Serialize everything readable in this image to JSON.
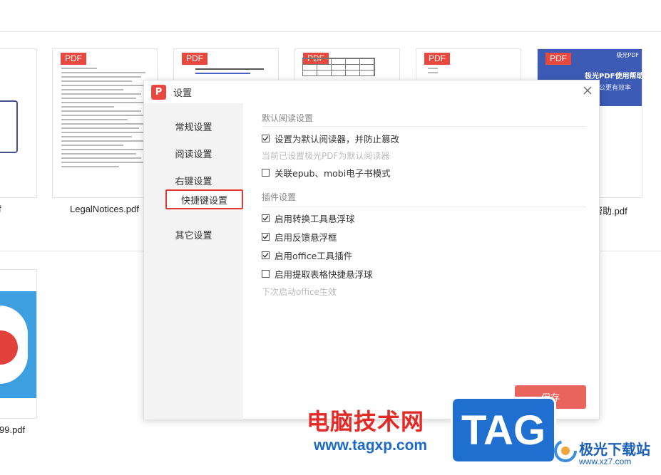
{
  "files": [
    {
      "name": "LegalNotices.pdf",
      "badge": "PDF"
    },
    {
      "name": "",
      "badge": "PDF"
    },
    {
      "name": "",
      "badge": "PDF"
    },
    {
      "name": "",
      "badge": "PDF"
    },
    {
      "name": "帮助.pdf",
      "badge": "PDF",
      "banner": "极光PDF使用帮助",
      "banner_sub": "公更有效率",
      "brand": "极光PDF"
    },
    {
      "name": "99.pdf"
    },
    {
      "name": "f"
    }
  ],
  "dialog": {
    "title": "设置",
    "logo_letter": "P",
    "nav": [
      "常规设置",
      "阅读设置",
      "右键设置",
      "快捷键设置",
      "其它设置"
    ],
    "active_nav": "快捷键设置",
    "section_reader": {
      "title": "默认阅读设置",
      "options": [
        {
          "label": "设置为默认阅读器，并防止篡改",
          "checked": true
        }
      ],
      "note": "当前已设置极光PDF为默认阅读器",
      "options2": [
        {
          "label": "关联epub、mobi电子书模式",
          "checked": false
        }
      ]
    },
    "section_plugin": {
      "title": "插件设置",
      "options": [
        {
          "label": "启用转换工具悬浮球",
          "checked": true
        },
        {
          "label": "启用反馈悬浮框",
          "checked": true
        },
        {
          "label": "启用office工具插件",
          "checked": true
        },
        {
          "label": "启用提取表格快捷悬浮球",
          "checked": false
        }
      ],
      "note": "下次启动office生效"
    },
    "save_label": "保存"
  },
  "watermark": {
    "cn_text": "电脑技术网",
    "url": "www.tagxp.com",
    "tag": "TAG",
    "jg_name": "极光下载站",
    "jg_url": "www.xz7.com"
  },
  "colors": {
    "accent": "#e8493f",
    "active_border": "#e23b34",
    "save_bg": "#e8645d"
  }
}
